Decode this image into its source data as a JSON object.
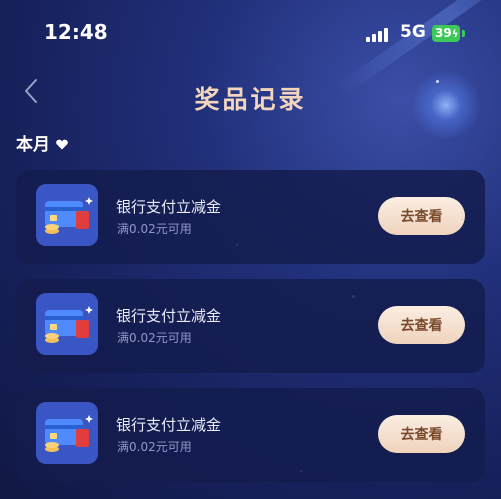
{
  "status_bar": {
    "time": "12:48",
    "network": "5G",
    "battery": "39"
  },
  "header": {
    "title": "奖品记录",
    "back_icon": "chevron-left-icon"
  },
  "filter": {
    "month_label": "本月",
    "dropdown_icon": "heart-icon"
  },
  "records": [
    {
      "title": "银行支付立减金",
      "condition": "满0.02元可用",
      "button_label": "去查看",
      "thumb_icon": "bank-card-icon"
    },
    {
      "title": "银行支付立减金",
      "condition": "满0.02元可用",
      "button_label": "去查看",
      "thumb_icon": "bank-card-icon"
    },
    {
      "title": "银行支付立减金",
      "condition": "满0.02元可用",
      "button_label": "去查看",
      "thumb_icon": "bank-card-icon"
    }
  ],
  "colors": {
    "title": "#f3d6bd",
    "button_bg": "#f4dcc8",
    "button_text": "#7a4a2c",
    "background": "#1b2766",
    "battery": "#3ec85a"
  }
}
